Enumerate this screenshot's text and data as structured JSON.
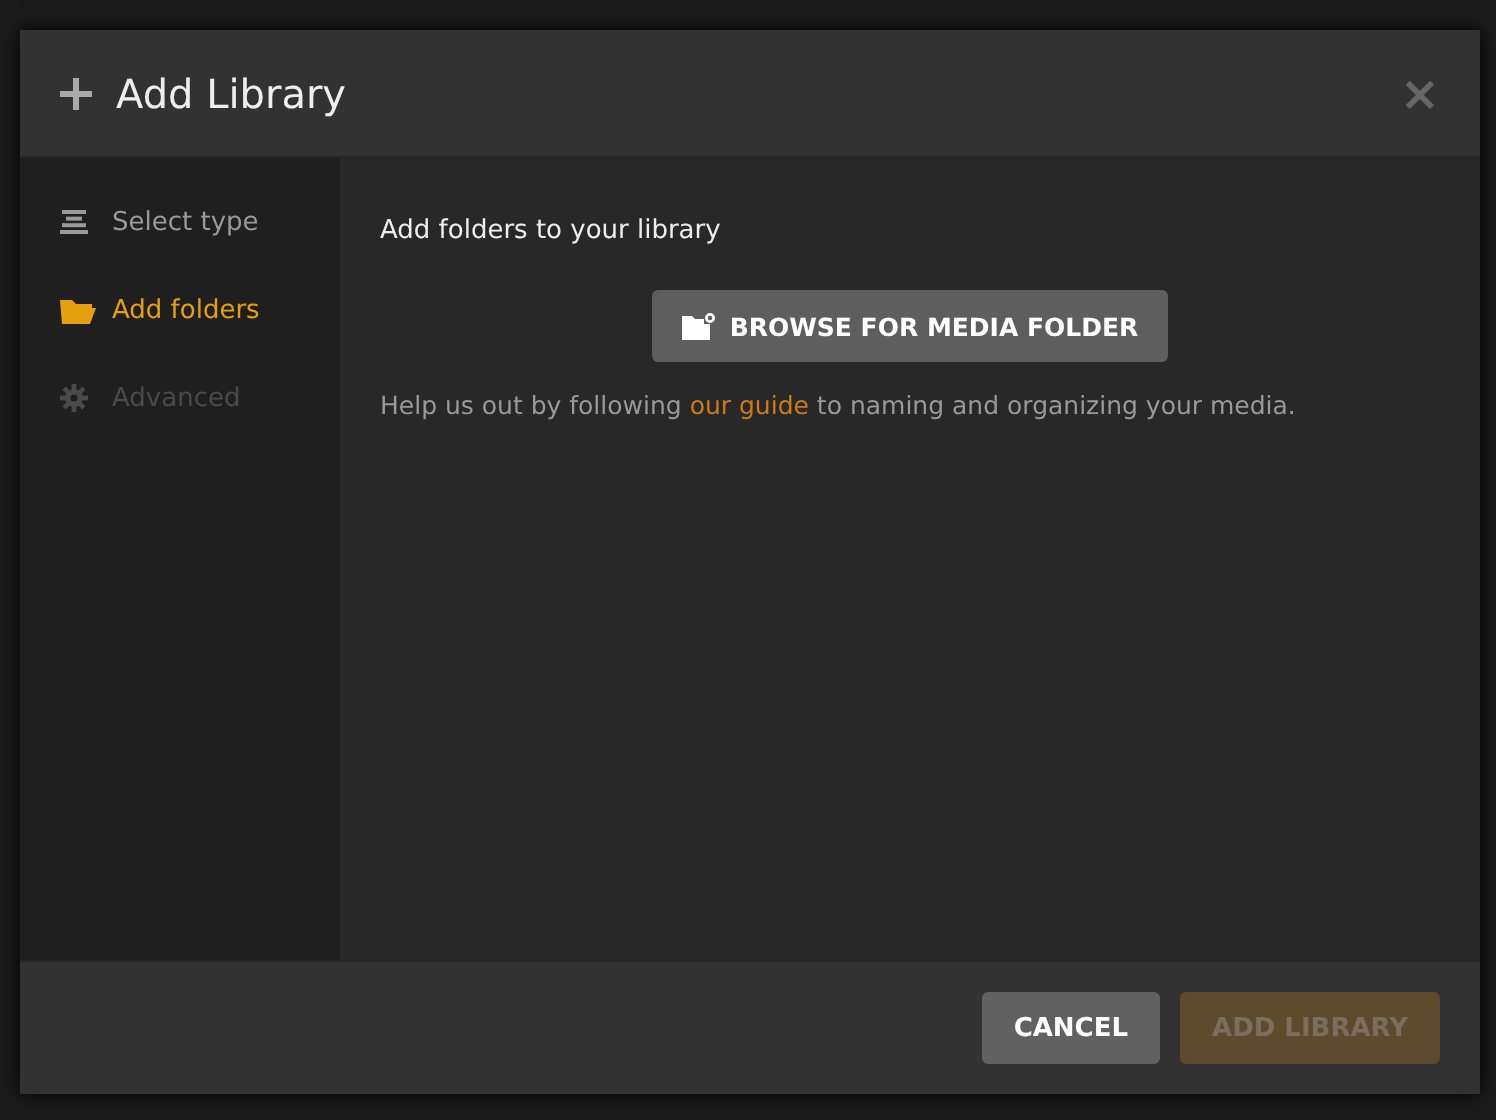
{
  "dialog": {
    "title": "Add Library",
    "close": "×"
  },
  "sidebar": {
    "items": [
      {
        "label": "Select type",
        "kind": "type",
        "selected": false,
        "disabled": false
      },
      {
        "label": "Add folders",
        "kind": "folders",
        "selected": true,
        "disabled": false
      },
      {
        "label": "Advanced",
        "kind": "advanced",
        "selected": false,
        "disabled": true
      }
    ]
  },
  "content": {
    "heading": "Add folders to your library",
    "browse_button": "BROWSE FOR MEDIA FOLDER",
    "help": {
      "before": "Help us out by following ",
      "link": "our guide",
      "after": " to naming and organizing your media."
    }
  },
  "footer": {
    "buttons": [
      {
        "label": "CANCEL",
        "kind": "secondary",
        "disabled": false
      },
      {
        "label": "ADD LIBRARY",
        "kind": "primary",
        "disabled": true
      }
    ]
  }
}
